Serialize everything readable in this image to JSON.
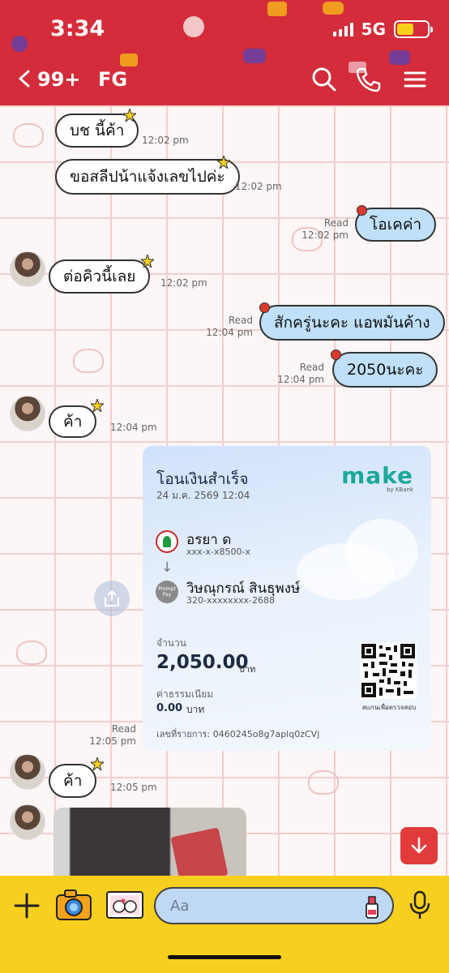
{
  "status_bar": {
    "time": "3:34",
    "network": "5G"
  },
  "header": {
    "unread_count": "99+",
    "chat_name": "FG"
  },
  "messages": [
    {
      "dir": "in",
      "text": "บช นี้ค้า",
      "time": "12:02 pm"
    },
    {
      "dir": "in",
      "text": "ขอสลีปน้าแจ้งเลขไปค่ะ",
      "time": "12:02 pm"
    },
    {
      "dir": "out",
      "text": "โอเคค่า",
      "read": "Read",
      "time": "12:02 pm"
    },
    {
      "dir": "in",
      "text": "ต่อคิวนี้เลย",
      "time": "12:02 pm"
    },
    {
      "dir": "out",
      "text": "สักครู่นะคะ แอพมันค้าง",
      "read": "Read",
      "time": "12:04 pm"
    },
    {
      "dir": "out",
      "text": "2050นะคะ",
      "read": "Read",
      "time": "12:04 pm"
    },
    {
      "dir": "in",
      "text": "ค้า",
      "time": "12:04 pm"
    },
    {
      "dir": "out_slip",
      "read": "Read",
      "time": "12:05 pm"
    },
    {
      "dir": "in",
      "text": "ค้า",
      "time": "12:05 pm"
    }
  ],
  "slip": {
    "title": "โอนเงินสำเร็จ",
    "datetime": "24 ม.ค. 2569 12:04",
    "brand": "make",
    "brand_sub": "by KBank",
    "from_name": "อรยา ด",
    "from_account": "xxx-x-x8500-x",
    "to_badge": "Prompt Pay",
    "to_name": "วิษณุกรณ์ สินธุพงษ์",
    "to_account": "320-xxxxxxxx-2688",
    "amount_label": "จำนวน",
    "amount": "2,050.00",
    "amount_unit": "บาท",
    "fee_label": "ค่าธรรมเนียม",
    "fee": "0.00",
    "fee_unit": "บาท",
    "reference": "เลขที่รายการ: 0460245o8g7aplq0zCVj",
    "qr_caption": "สแกนเพื่อตรวจสอบ"
  },
  "input": {
    "placeholder": "Aa"
  },
  "colors": {
    "header": "#d42c3a",
    "input_bar": "#f7cf1e",
    "out_bubble": "#bfe0f8"
  }
}
